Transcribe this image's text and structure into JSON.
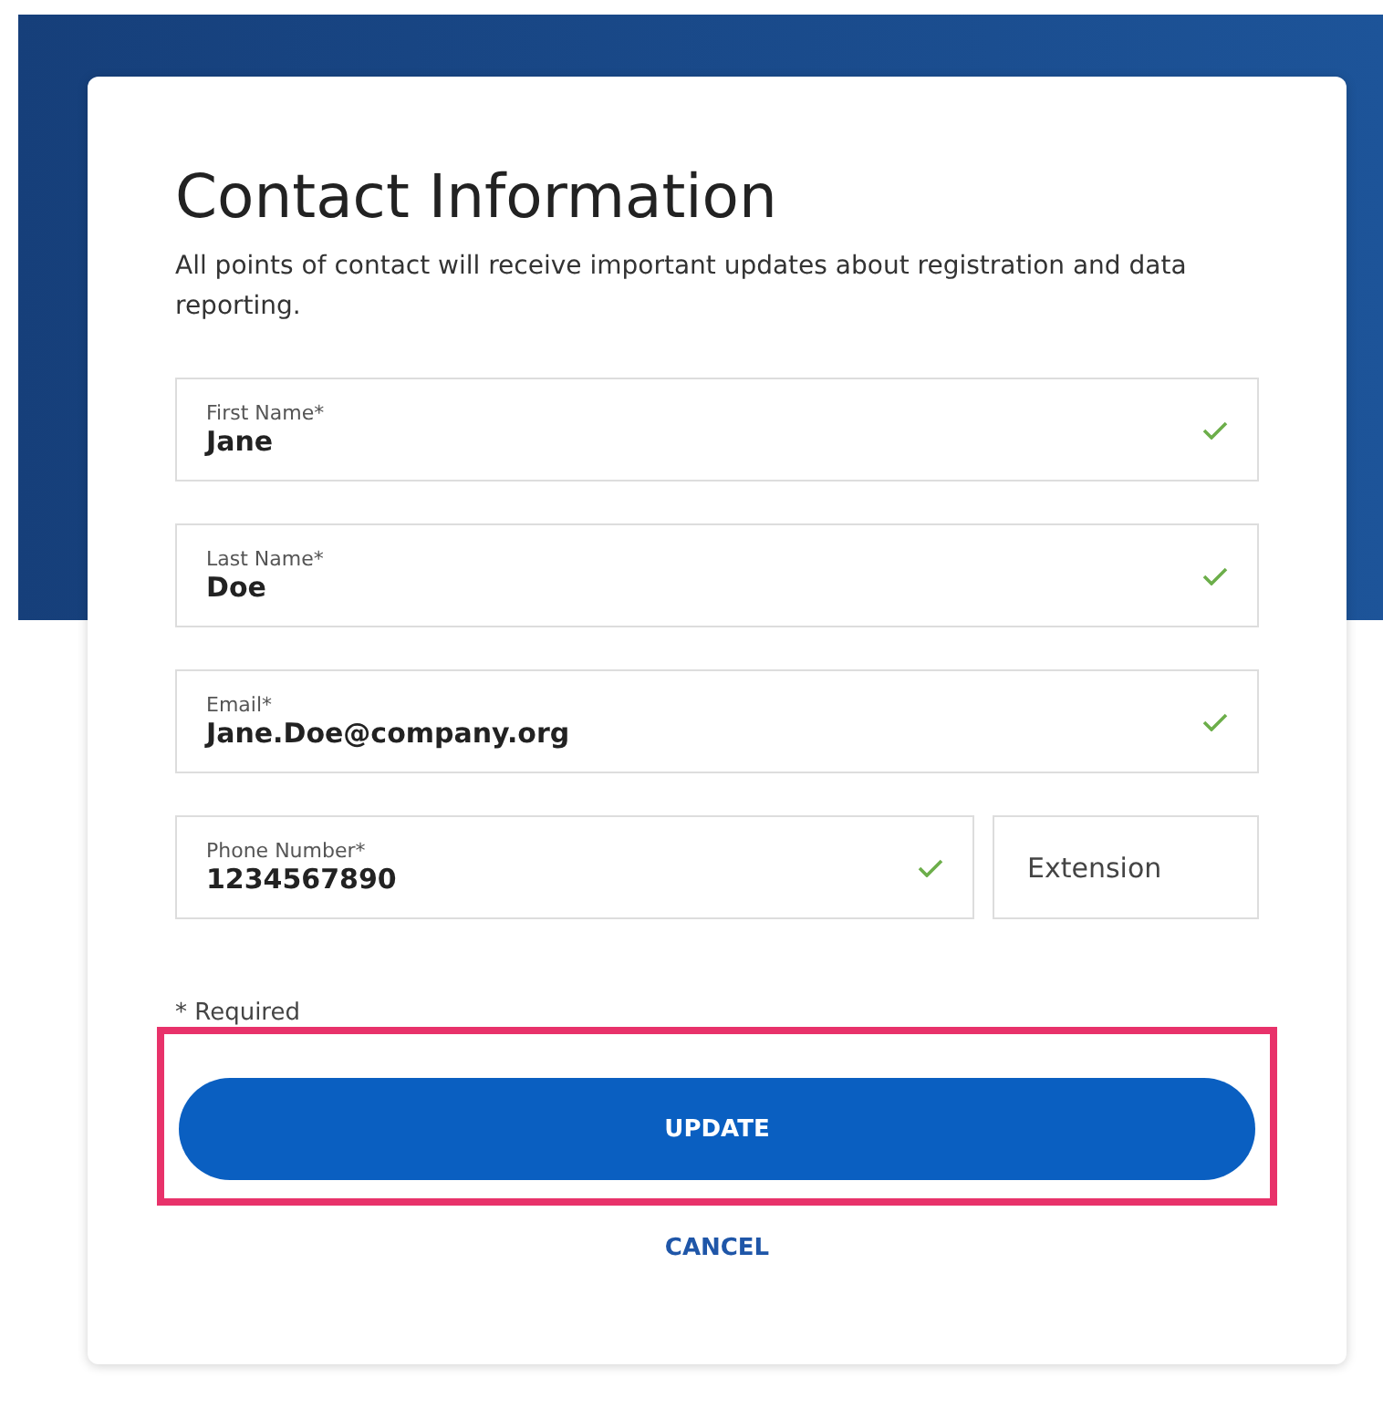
{
  "form": {
    "title": "Contact Information",
    "description": "All points of contact will receive important updates about registration and data reporting.",
    "fields": [
      {
        "label": "First Name*",
        "value": "Jane",
        "valid": true
      },
      {
        "label": "Last Name*",
        "value": "Doe",
        "valid": true
      },
      {
        "label": "Email*",
        "value": "Jane.Doe@company.org",
        "valid": true
      }
    ],
    "phone": {
      "label": "Phone Number*",
      "value": "1234567890",
      "valid": true
    },
    "extension": {
      "placeholder": "Extension"
    },
    "required_note": "* Required",
    "submit": {
      "label": "UPDATE",
      "highlighted": true
    },
    "cancel": {
      "label": "CANCEL"
    }
  }
}
